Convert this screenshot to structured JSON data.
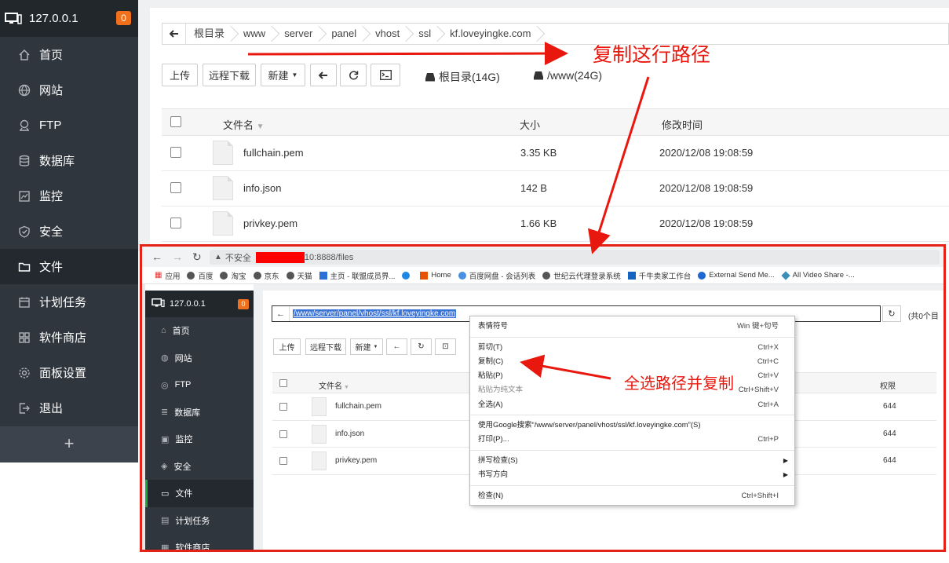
{
  "sidebar": {
    "host": "127.0.0.1",
    "badge": "0",
    "items": [
      {
        "label": "首页",
        "icon": "home-icon"
      },
      {
        "label": "网站",
        "icon": "globe-icon"
      },
      {
        "label": "FTP",
        "icon": "ftp-icon"
      },
      {
        "label": "数据库",
        "icon": "database-icon"
      },
      {
        "label": "监控",
        "icon": "monitor-icon"
      },
      {
        "label": "安全",
        "icon": "shield-icon"
      },
      {
        "label": "文件",
        "icon": "folder-icon",
        "active": true
      },
      {
        "label": "计划任务",
        "icon": "calendar-icon"
      },
      {
        "label": "软件商店",
        "icon": "apps-icon"
      },
      {
        "label": "面板设置",
        "icon": "gear-icon"
      },
      {
        "label": "退出",
        "icon": "logout-icon"
      }
    ],
    "add_label": "+"
  },
  "path": {
    "crumbs": [
      "根目录",
      "www",
      "server",
      "panel",
      "vhost",
      "ssl",
      "kf.loveyingke.com"
    ]
  },
  "toolbar": {
    "upload": "上传",
    "remote_download": "远程下载",
    "new": "新建",
    "disks": [
      "根目录(14G)",
      "/www(24G)"
    ]
  },
  "table": {
    "headers": {
      "name": "文件名",
      "size": "大小",
      "modified": "修改时间"
    },
    "rows": [
      {
        "name": "fullchain.pem",
        "size": "3.35 KB",
        "modified": "2020/12/08 19:08:59"
      },
      {
        "name": "info.json",
        "size": "142 B",
        "modified": "2020/12/08 19:08:59"
      },
      {
        "name": "privkey.pem",
        "size": "1.66 KB",
        "modified": "2020/12/08 19:08:59"
      }
    ]
  },
  "annotations": {
    "copy_path": "复制这行路径",
    "select_all_copy": "全选路径并复制",
    "color": "#e8180f"
  },
  "screenshot": {
    "browser": {
      "security": "不安全",
      "url_suffix": "10:8888/files",
      "bookmarks": [
        "应用",
        "百度",
        "淘宝",
        "京东",
        "天猫",
        "主页 - 联盟成员界...",
        "Home",
        "百度网盘 - 会话列表",
        "世纪云代理登录系统",
        "千牛卖家工作台",
        "External Send Me...",
        "All Video Share -..."
      ]
    },
    "sidebar": {
      "host": "127.0.0.1",
      "badge": "0",
      "items": [
        "首页",
        "网站",
        "FTP",
        "数据库",
        "监控",
        "安全",
        "文件",
        "计划任务",
        "软件商店"
      ]
    },
    "path_value": "/www/server/panel/vhost/ssl/kf.loveyingke.com",
    "total_label": "(共0个目",
    "toolbar": {
      "upload": "上传",
      "remote_download": "远程下载",
      "new": "新建"
    },
    "headers": {
      "name": "文件名",
      "perm": "权限"
    },
    "rows": [
      {
        "name": "fullchain.pem",
        "perm": "644"
      },
      {
        "name": "info.json",
        "perm": "644"
      },
      {
        "name": "privkey.pem",
        "perm": "644"
      }
    ],
    "context_menu": [
      {
        "label": "表情符号",
        "shortcut": "Win 键+句号"
      },
      {
        "label": "剪切(T)",
        "shortcut": "Ctrl+X"
      },
      {
        "label": "复制(C)",
        "shortcut": "Ctrl+C"
      },
      {
        "label": "粘贴(P)",
        "shortcut": "Ctrl+V"
      },
      {
        "label": "粘贴为纯文本",
        "shortcut": "Ctrl+Shift+V",
        "disabled": true
      },
      {
        "label": "全选(A)",
        "shortcut": "Ctrl+A"
      },
      {
        "label": "使用Google搜索“/www/server/panel/vhost/ssl/kf.loveyingke.com”(S)",
        "shortcut": ""
      },
      {
        "label": "打印(P)...",
        "shortcut": "Ctrl+P"
      },
      {
        "label": "拼写检查(S)",
        "shortcut": ""
      },
      {
        "label": "书写方向",
        "shortcut": ""
      },
      {
        "label": "检查(N)",
        "shortcut": "Ctrl+Shift+I"
      }
    ]
  }
}
